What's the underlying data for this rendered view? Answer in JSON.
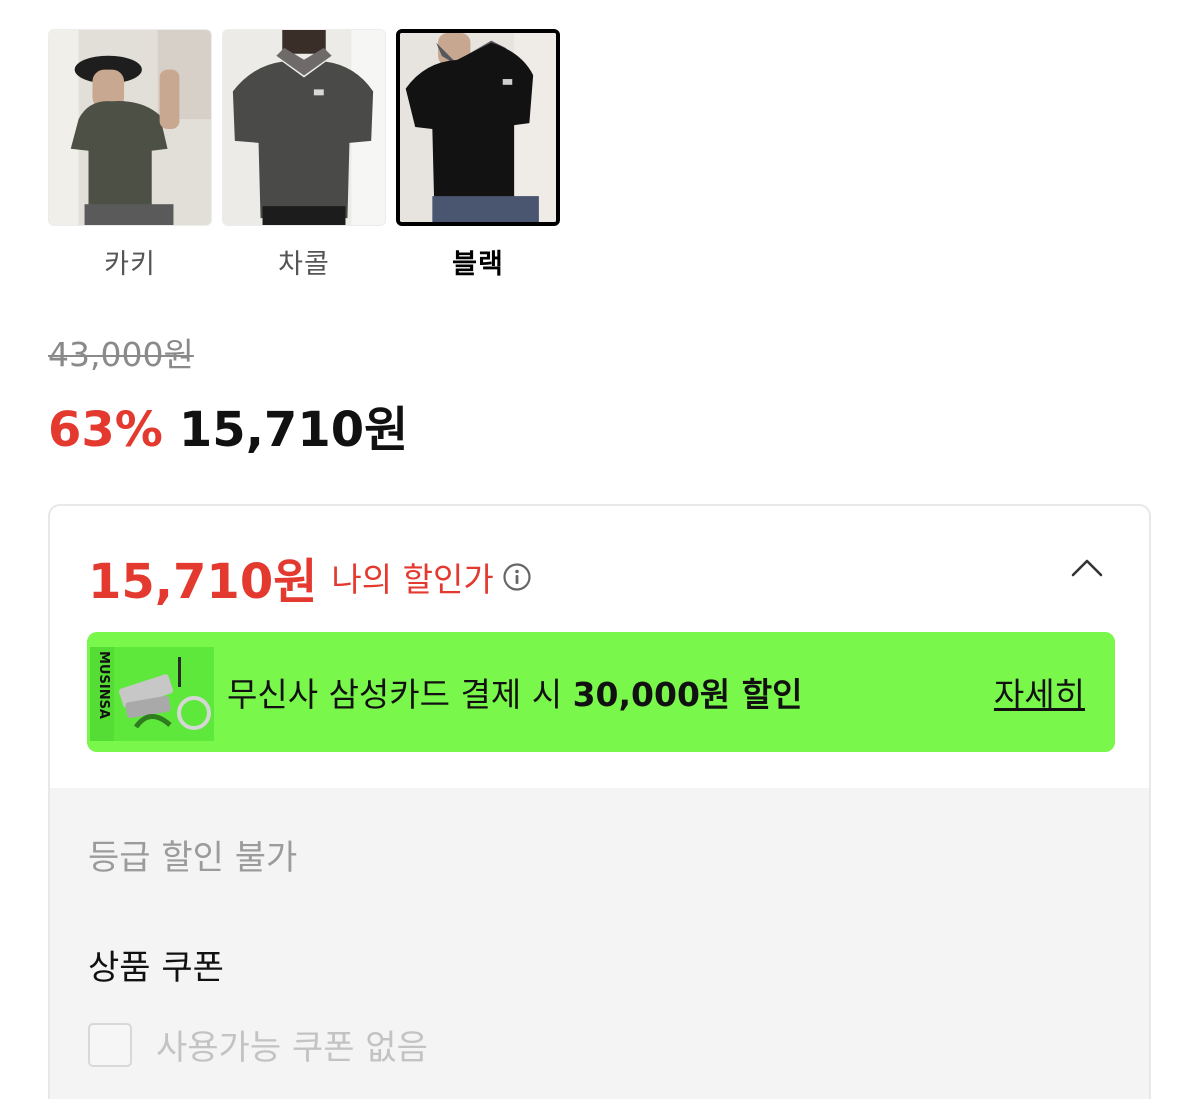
{
  "colors": {
    "selected_index": 2,
    "options": [
      {
        "label": "카키"
      },
      {
        "label": "차콜"
      },
      {
        "label": "블랙"
      }
    ]
  },
  "price": {
    "original": "43,000원",
    "discount_rate": "63%",
    "sale": "15,710원"
  },
  "benefit": {
    "my_price": "15,710원",
    "my_price_label": "나의 할인가",
    "card_promo_prefix": "무신사 삼성카드 결제 시",
    "card_promo_amount": "30,000원 할인",
    "card_promo_detail": "자세히",
    "card_brand_text": "MUSINSA",
    "grade_discount": "등급 할인 불가",
    "coupon_title": "상품 쿠폰",
    "coupon_none": "사용가능 쿠폰 없음"
  },
  "theme": {
    "accent_red": "#e3392f",
    "banner_green": "#79f74a"
  }
}
